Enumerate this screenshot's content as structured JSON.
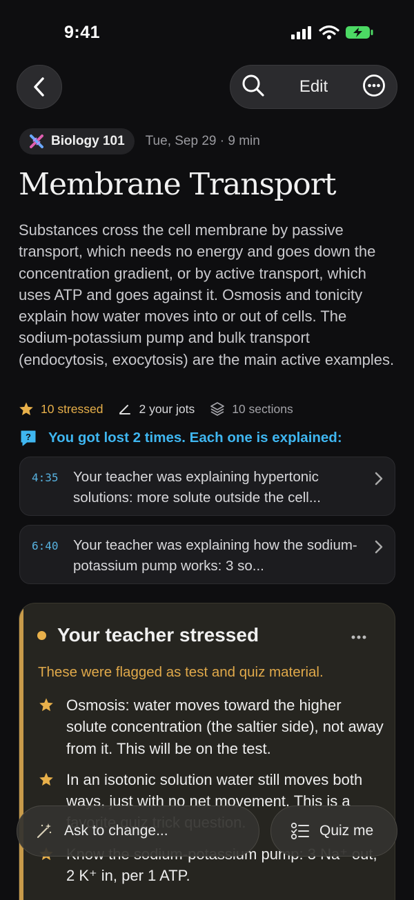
{
  "status_bar": {
    "time": "9:41"
  },
  "toolbar": {
    "edit_label": "Edit"
  },
  "course": {
    "name": "Biology 101",
    "date_meta": "Tue, Sep 29 · 9 min"
  },
  "note": {
    "title": "Membrane Transport",
    "summary": "Substances cross the cell membrane by passive transport, which needs no energy and goes down the concentration gradient, or by active transport, which uses ATP and goes against it. Osmosis and tonicity explain how water moves into or out of cells. The sodium-potassium pump and bulk transport (endocytosis, exocytosis) are the main active examples."
  },
  "stats": {
    "stressed": "10 stressed",
    "jots": "2 your jots",
    "sections": "10 sections"
  },
  "lost": {
    "heading": "You got lost 2 times. Each one is explained:",
    "items": [
      {
        "time": "4:35",
        "text": "Your teacher was explaining hypertonic solutions: more solute outside the cell..."
      },
      {
        "time": "6:40",
        "text": "Your teacher was explaining how the sodium-potassium pump works: 3 so..."
      }
    ]
  },
  "stressed_card": {
    "title": "Your teacher stressed",
    "subtitle": "These were flagged as test and quiz material.",
    "items": [
      "Osmosis: water moves toward the higher solute concentration (the saltier side), not away from it. This will be on the test.",
      "In an isotonic solution water still moves both ways, just with no net movement. This is a favorite quiz trick question.",
      "Know the sodium-potassium pump: 3 Na⁺ out, 2 K⁺ in, per 1 ATP."
    ]
  },
  "actions": {
    "ask_label": "Ask to change...",
    "quiz_label": "Quiz me"
  },
  "colors": {
    "accent_gold": "#e8b04a",
    "accent_blue": "#3fb6f0",
    "battery_green": "#4cd964"
  }
}
